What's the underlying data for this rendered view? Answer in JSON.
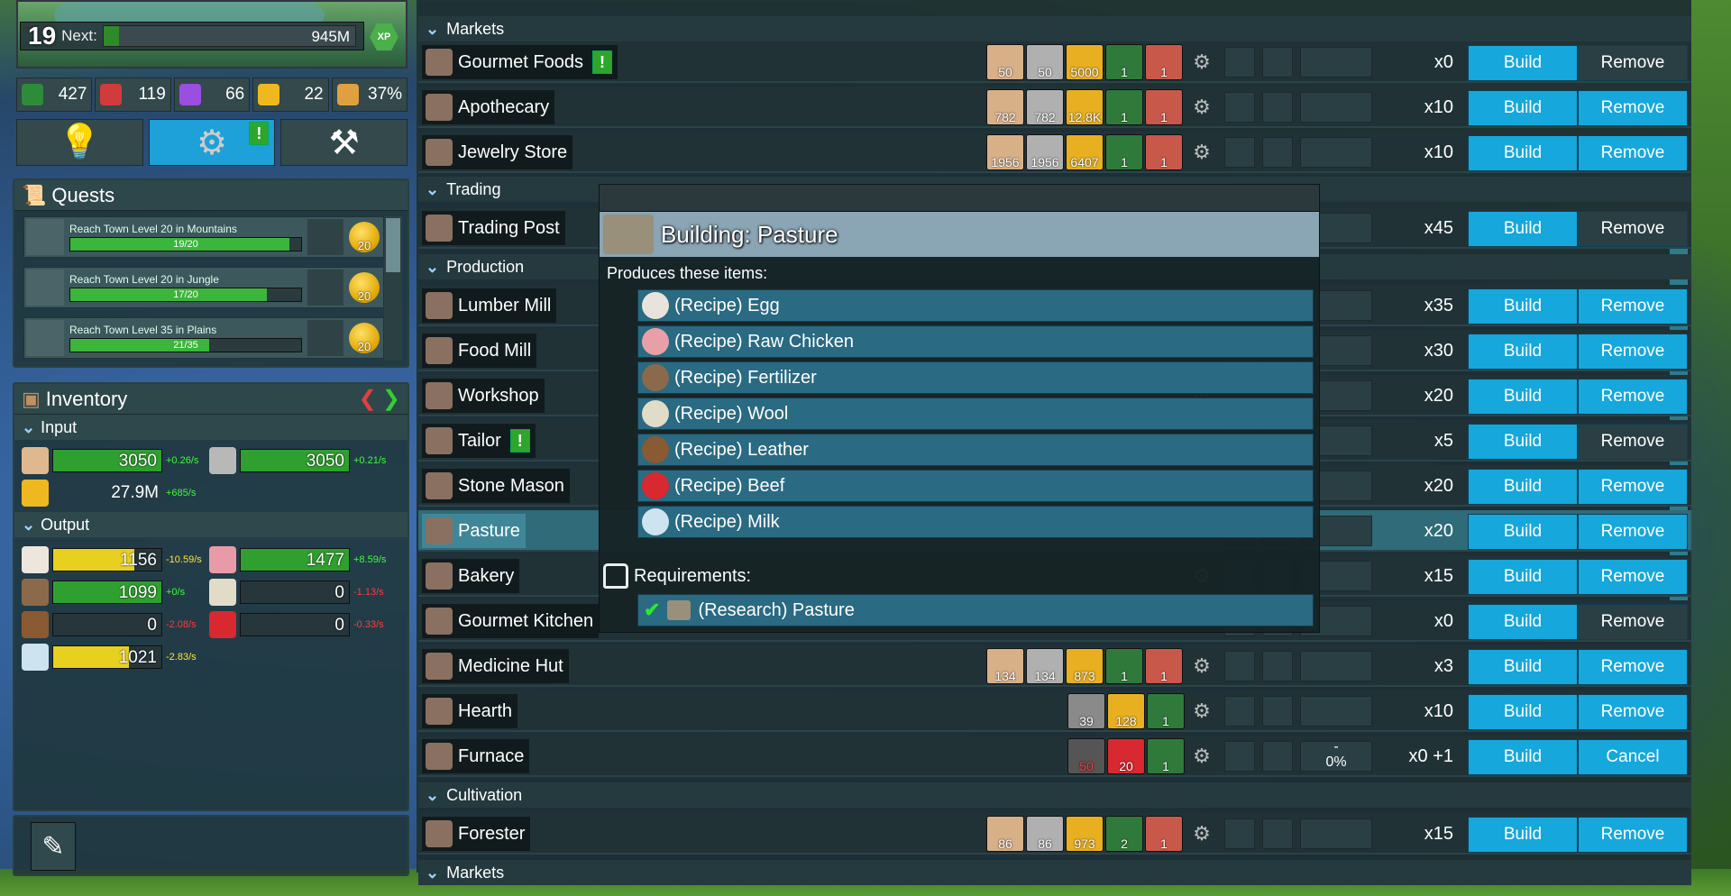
{
  "player": {
    "level": "19",
    "next_label": "Next:",
    "next_value": "945M",
    "xp_label": "XP"
  },
  "stats": [
    {
      "icon": "cash-icon",
      "value": "427",
      "color": "#2e8b3a"
    },
    {
      "icon": "population-icon",
      "value": "119",
      "color": "#d23b3b"
    },
    {
      "icon": "gem-icon",
      "value": "66",
      "color": "#9b4fe0"
    },
    {
      "icon": "star-icon",
      "value": "22",
      "color": "#f0b820"
    },
    {
      "icon": "happiness-icon",
      "value": "37%",
      "color": "#e0a040"
    }
  ],
  "quests": {
    "title": "Quests",
    "items": [
      {
        "text": "Reach Town Level 20 in Mountains",
        "progress": "19/20",
        "fraction": 0.95,
        "reward": "20"
      },
      {
        "text": "Reach Town Level 20 in Jungle",
        "progress": "17/20",
        "fraction": 0.85,
        "reward": "20"
      },
      {
        "text": "Reach Town Level 35 in Plains",
        "progress": "21/35",
        "fraction": 0.6,
        "reward": "20"
      }
    ]
  },
  "inventory": {
    "title": "Inventory",
    "input_label": "Input",
    "output_label": "Output",
    "input": [
      {
        "icon": "wood-plank-icon",
        "value": "3050",
        "rate": "+0.26/s",
        "rate_color": "green",
        "fraction": 1.0
      },
      {
        "icon": "stone-icon",
        "value": "3050",
        "rate": "+0.21/s",
        "rate_color": "green",
        "fraction": 1.0
      },
      {
        "icon": "gold-coin-icon",
        "value": "27.9M",
        "rate": "+685/s",
        "rate_color": "green"
      }
    ],
    "output": [
      {
        "icon": "egg-icon",
        "value": "1156",
        "rate": "-10.59/s",
        "rate_color": "yellow",
        "fraction": 0.75,
        "bar": "yellow"
      },
      {
        "icon": "raw-chicken-icon",
        "value": "1477",
        "rate": "+8.59/s",
        "rate_color": "green",
        "fraction": 1.0,
        "bar": "green"
      },
      {
        "icon": "fertilizer-icon",
        "value": "1099",
        "rate": "+0/s",
        "rate_color": "green",
        "fraction": 1.0,
        "bar": "green"
      },
      {
        "icon": "wool-icon",
        "value": "0",
        "rate": "-1.13/s",
        "rate_color": "red",
        "fraction": 0,
        "bar": "none"
      },
      {
        "icon": "leather-icon",
        "value": "0",
        "rate": "-2.08/s",
        "rate_color": "red",
        "fraction": 0,
        "bar": "none"
      },
      {
        "icon": "beef-icon",
        "value": "0",
        "rate": "-0.33/s",
        "rate_color": "red",
        "fraction": 0,
        "bar": "none"
      },
      {
        "icon": "milk-icon",
        "value": "1021",
        "rate": "-2.83/s",
        "rate_color": "yellow",
        "fraction": 0.7,
        "bar": "yellow"
      }
    ]
  },
  "categories": {
    "markets": "Markets",
    "trading": "Trading",
    "production": "Production",
    "cultivation": "Cultivation",
    "markets_bottom": "Markets"
  },
  "buttons": {
    "build": "Build",
    "remove": "Remove",
    "cancel": "Cancel"
  },
  "buildings": [
    {
      "name": "Gourmet Foods",
      "alert": true,
      "costs": [
        "50",
        "50",
        "5000",
        "1",
        "1"
      ],
      "count": "x0",
      "remove_enabled": false
    },
    {
      "name": "Apothecary",
      "costs": [
        "782",
        "782",
        "12.8K",
        "1",
        "1"
      ],
      "count": "x10",
      "remove_enabled": true
    },
    {
      "name": "Jewelry Store",
      "costs": [
        "1956",
        "1956",
        "6407",
        "1",
        "1"
      ],
      "count": "x10",
      "remove_enabled": true
    },
    {
      "name": "Trading Post",
      "count": "x45",
      "remove_enabled": false
    },
    {
      "name": "Lumber Mill",
      "count": "x35",
      "remove_enabled": true
    },
    {
      "name": "Food Mill",
      "count": "x30",
      "remove_enabled": true
    },
    {
      "name": "Workshop",
      "count": "x20",
      "remove_enabled": true
    },
    {
      "name": "Tailor",
      "alert": true,
      "count": "x5",
      "remove_enabled": false
    },
    {
      "name": "Stone Mason",
      "count": "x20",
      "remove_enabled": true
    },
    {
      "name": "Pasture",
      "count": "x20",
      "remove_enabled": true,
      "selected": true
    },
    {
      "name": "Bakery",
      "count": "x15",
      "remove_enabled": true
    },
    {
      "name": "Gourmet Kitchen",
      "count": "x0",
      "remove_enabled": false
    },
    {
      "name": "Medicine Hut",
      "costs": [
        "134",
        "134",
        "873",
        "1",
        "1"
      ],
      "count": "x3",
      "remove_enabled": true
    },
    {
      "name": "Hearth",
      "costs": [
        "39",
        "128",
        "1"
      ],
      "count": "x10",
      "remove_enabled": true
    },
    {
      "name": "Furnace",
      "costs": [
        "50",
        "20",
        "1"
      ],
      "count": "x0 +1",
      "progress_top": "-",
      "progress_pct": "0%",
      "remove_label": "Cancel"
    },
    {
      "name": "Forester",
      "costs": [
        "86",
        "86",
        "973",
        "2",
        "1"
      ],
      "count": "x15",
      "remove_enabled": true
    }
  ],
  "popup": {
    "title": "Building: Pasture",
    "produces_label": "Produces these items:",
    "recipes": [
      {
        "label": "(Recipe) Egg",
        "icon": "egg-icon",
        "color": "#e8e4dc"
      },
      {
        "label": "(Recipe) Raw Chicken",
        "icon": "raw-chicken-icon",
        "color": "#e8a0a8"
      },
      {
        "label": "(Recipe) Fertilizer",
        "icon": "fertilizer-icon",
        "color": "#8a6a4a"
      },
      {
        "label": "(Recipe) Wool",
        "icon": "wool-icon",
        "color": "#e0dcc8"
      },
      {
        "label": "(Recipe) Leather",
        "icon": "leather-icon",
        "color": "#8a5a32"
      },
      {
        "label": "(Recipe) Beef",
        "icon": "beef-icon",
        "color": "#d82830"
      },
      {
        "label": "(Recipe) Milk",
        "icon": "milk-icon",
        "color": "#cde4f0"
      }
    ],
    "requirements_label": "Requirements:",
    "requirement": "(Research) Pasture"
  }
}
